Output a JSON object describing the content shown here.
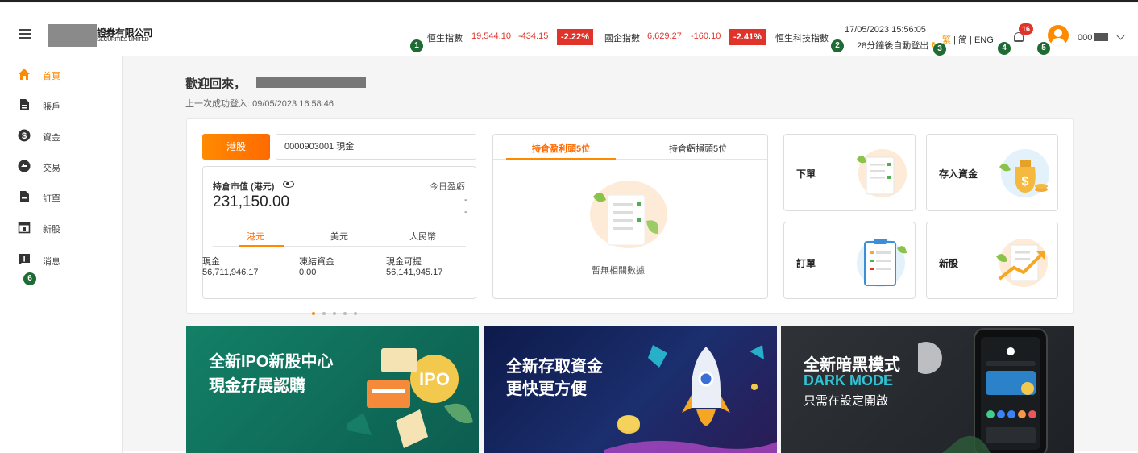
{
  "header": {
    "company_zh": "證券有限公司",
    "company_en": "SECURITIES LIMITED",
    "markers": [
      "1",
      "2",
      "3",
      "4",
      "5",
      "6"
    ],
    "indices": [
      {
        "name": "恒生指數",
        "value": "19,544.10",
        "change": "-434.15",
        "pct": "-2.22%"
      },
      {
        "name": "國企指數",
        "value": "6,629.27",
        "change": "-160.10",
        "pct": "-2.41%"
      },
      {
        "name": "恒生科技指數"
      }
    ],
    "datetime": "17/05/2023 15:56:05",
    "auto_logout": "28分鐘後自動登出",
    "lang": {
      "tc": "繁",
      "sep1": "|",
      "sc": "简",
      "sep2": "|",
      "en": "ENG"
    },
    "notif_count": "16",
    "user": "000"
  },
  "sidebar": {
    "items": [
      {
        "label": "首頁",
        "icon": "home-icon"
      },
      {
        "label": "賬戶",
        "icon": "document-icon"
      },
      {
        "label": "資金",
        "icon": "dollar-icon"
      },
      {
        "label": "交易",
        "icon": "exchange-icon"
      },
      {
        "label": "訂單",
        "icon": "order-icon"
      },
      {
        "label": "新股",
        "icon": "calendar-icon"
      },
      {
        "label": "消息",
        "icon": "message-icon"
      }
    ]
  },
  "welcome": {
    "title": "歡迎回來，",
    "last_login": "上一次成功登入: 09/05/2023 16:58:46"
  },
  "portfolio": {
    "market_tab": "港股",
    "account": "0000903001 現金",
    "value_label": "持倉市值 (港元)",
    "value": "231,150.00",
    "today_pl_label": "今日盈虧",
    "dash": "-",
    "currencies": [
      "港元",
      "美元",
      "人民幣"
    ],
    "balances": [
      {
        "label": "現金",
        "value": "56,711,946.17"
      },
      {
        "label": "凍結資金",
        "value": "0.00"
      },
      {
        "label": "現金可提",
        "value": "56,141,945.17"
      }
    ]
  },
  "pl_panel": {
    "tabs": [
      "持倉盈利頭5位",
      "持倉虧損頭5位"
    ],
    "empty": "暫無相關數據"
  },
  "quick_actions": [
    "下單",
    "存入資金",
    "訂單",
    "新股"
  ],
  "banners": [
    {
      "line1": "全新IPO新股中心",
      "line2": "現金孖展認購",
      "tag": "IPO"
    },
    {
      "line1": "全新存取資金",
      "line2": "更快更方便"
    },
    {
      "line1": "全新暗黑模式",
      "line2": "DARK MODE",
      "line3": "只需在設定開啟"
    }
  ],
  "colors": {
    "accent": "#ff8a00",
    "down": "#e0342b",
    "marker": "#1f6b34"
  }
}
